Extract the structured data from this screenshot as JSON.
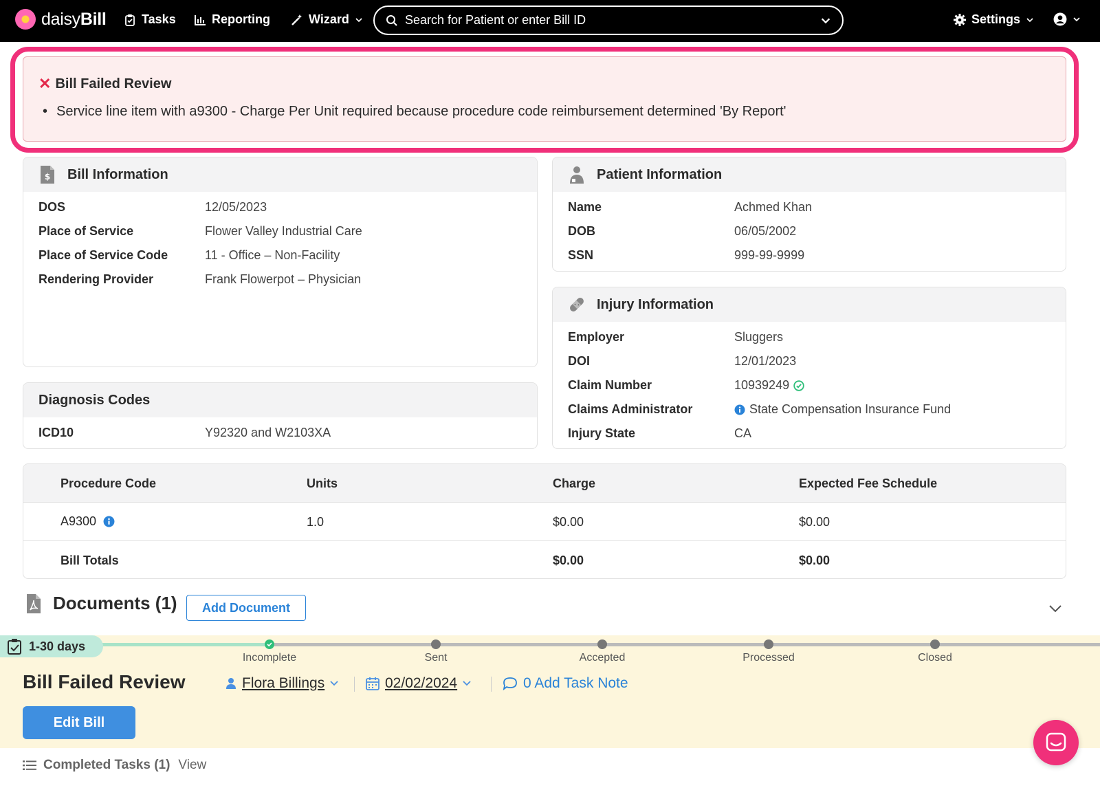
{
  "nav": {
    "brand_light": "daisy",
    "brand_bold": "Bill",
    "tasks": "Tasks",
    "reporting": "Reporting",
    "wizard": "Wizard",
    "search_placeholder": "Search for Patient or enter Bill ID",
    "settings": "Settings"
  },
  "alert": {
    "title": "Bill Failed Review",
    "items": [
      "Service line item with a9300 - Charge Per Unit required because procedure code reimbursement determined 'By Report'"
    ]
  },
  "bill_info": {
    "title": "Bill Information",
    "rows": [
      {
        "label": "DOS",
        "value": "12/05/2023"
      },
      {
        "label": "Place of Service",
        "value": "Flower Valley Industrial Care"
      },
      {
        "label": "Place of Service Code",
        "value": "11 - Office – Non-Facility"
      },
      {
        "label": "Rendering Provider",
        "value": "Frank Flowerpot – Physician"
      }
    ]
  },
  "patient_info": {
    "title": "Patient Information",
    "rows": [
      {
        "label": "Name",
        "value": "Achmed Khan"
      },
      {
        "label": "DOB",
        "value": "06/05/2002"
      },
      {
        "label": "SSN",
        "value": "999-99-9999"
      }
    ]
  },
  "diagnosis": {
    "title": "Diagnosis Codes",
    "rows": [
      {
        "label": "ICD10",
        "value": "Y92320 and W2103XA"
      }
    ]
  },
  "injury_info": {
    "title": "Injury Information",
    "rows": [
      {
        "label": "Employer",
        "value": "Sluggers"
      },
      {
        "label": "DOI",
        "value": "12/01/2023"
      },
      {
        "label": "Claim Number",
        "value": "10939249"
      },
      {
        "label": "Claims Administrator",
        "value": "State Compensation Insurance Fund"
      },
      {
        "label": "Injury State",
        "value": "CA"
      }
    ]
  },
  "procedures": {
    "headers": [
      "Procedure Code",
      "Units",
      "Charge",
      "Expected Fee Schedule"
    ],
    "rows": [
      [
        "A9300",
        "1.0",
        "$0.00",
        "$0.00"
      ]
    ],
    "totals_label": "Bill Totals",
    "totals": [
      "$0.00",
      "$0.00"
    ]
  },
  "documents": {
    "title": "Documents (1)",
    "add_button": "Add Document"
  },
  "task": {
    "days_badge": "1-30 days",
    "steps": [
      "Incomplete",
      "Sent",
      "Accepted",
      "Processed",
      "Closed"
    ],
    "title": "Bill Failed Review",
    "assignee": "Flora Billings",
    "due_date": "02/02/2024",
    "note": "0 Add Task Note",
    "edit_button": "Edit Bill"
  },
  "completed_tasks": {
    "label": "Completed Tasks (1)",
    "link": "View"
  },
  "colors": {
    "accent": "#2a83d8",
    "alert_border": "#f0307a",
    "alert_bg": "#fdeeee",
    "task_bg": "#fdf6dc",
    "success": "#2fbf7a"
  }
}
